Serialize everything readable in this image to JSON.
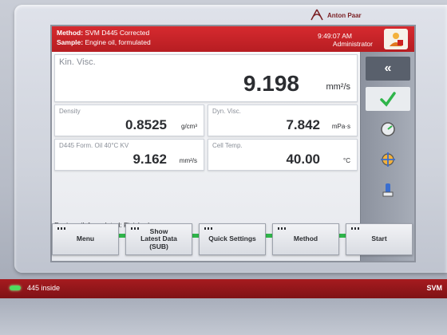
{
  "device": {
    "brand": "Anton Paar"
  },
  "header": {
    "method_label": "Method:",
    "method_value": "SVM D445 Corrected",
    "sample_label": "Sample:",
    "sample_value": "Engine oil, formulated",
    "time": "9:49:07 AM",
    "user": "Administrator",
    "user_icon": "user-icon"
  },
  "results": {
    "kin_visc": {
      "label": "Kin. Visc.",
      "value": "9.198",
      "unit": "mm²/s"
    },
    "density": {
      "label": "Density",
      "value": "0.8525",
      "unit": "g/cm³"
    },
    "dyn_visc": {
      "label": "Dyn. Visc.",
      "value": "7.842",
      "unit": "mPa·s"
    },
    "d445_kv": {
      "label": "D445 Form. Oil 40°C KV",
      "value": "9.162",
      "unit": "mm²/s"
    },
    "cell_temp": {
      "label": "Cell Temp.",
      "value": "40.00",
      "unit": "°C"
    }
  },
  "status": {
    "text": "Engine oil, formulated: Finished",
    "progress_fraction": 1.0,
    "progress_color": "#2fb54a"
  },
  "side_buttons": [
    "collapse-icon",
    "checkmark-icon",
    "gauge-icon",
    "target-icon",
    "sample-changer-icon"
  ],
  "softkeys": {
    "menu": "Menu",
    "show_latest_line1": "Show",
    "show_latest_line2": "Latest Data",
    "show_latest_line3": "(SUB)",
    "quick_settings": "Quick Settings",
    "method": "Method",
    "start": "Start"
  },
  "footer": {
    "status_text": "445 inside",
    "model": "SVM"
  },
  "colors": {
    "accent_red": "#c4242a",
    "ok_green": "#2fb54a"
  }
}
